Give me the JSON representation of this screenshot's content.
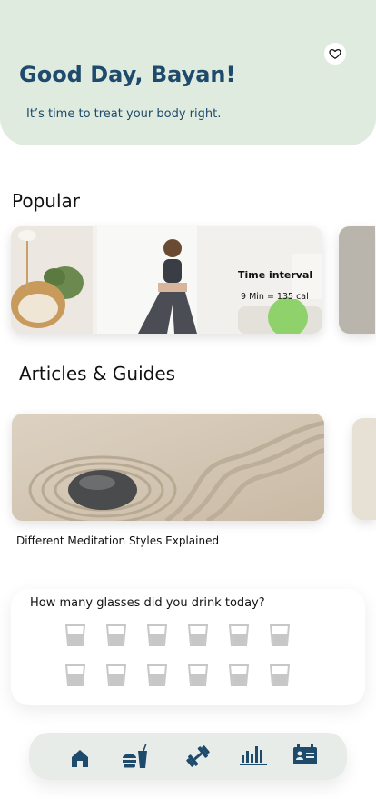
{
  "header": {
    "greeting": "Good Day, Bayan!",
    "subtitle": "It’s time to treat your body right.",
    "favorite_icon": "heart-icon"
  },
  "popular": {
    "title": "Popular",
    "card": {
      "title": "Time interval",
      "detail": "9 Min = 135 cal"
    }
  },
  "articles": {
    "title": "Articles & Guides",
    "card": {
      "label": "Different Meditation Styles Explained"
    }
  },
  "water": {
    "question": "How many glasses did you drink today?",
    "glasses": 12,
    "glasses_filled": 0
  },
  "nav": {
    "items": [
      {
        "icon": "home-icon",
        "active": true
      },
      {
        "icon": "food-drink-icon",
        "active": false
      },
      {
        "icon": "dumbbell-icon",
        "active": false
      },
      {
        "icon": "stats-chart-icon",
        "active": false
      },
      {
        "icon": "profile-card-icon",
        "active": false
      }
    ]
  },
  "colors": {
    "header_bg": "#e0ebe0",
    "brand_blue": "#1e4a6b",
    "glass_gray": "#c7c7c7"
  }
}
